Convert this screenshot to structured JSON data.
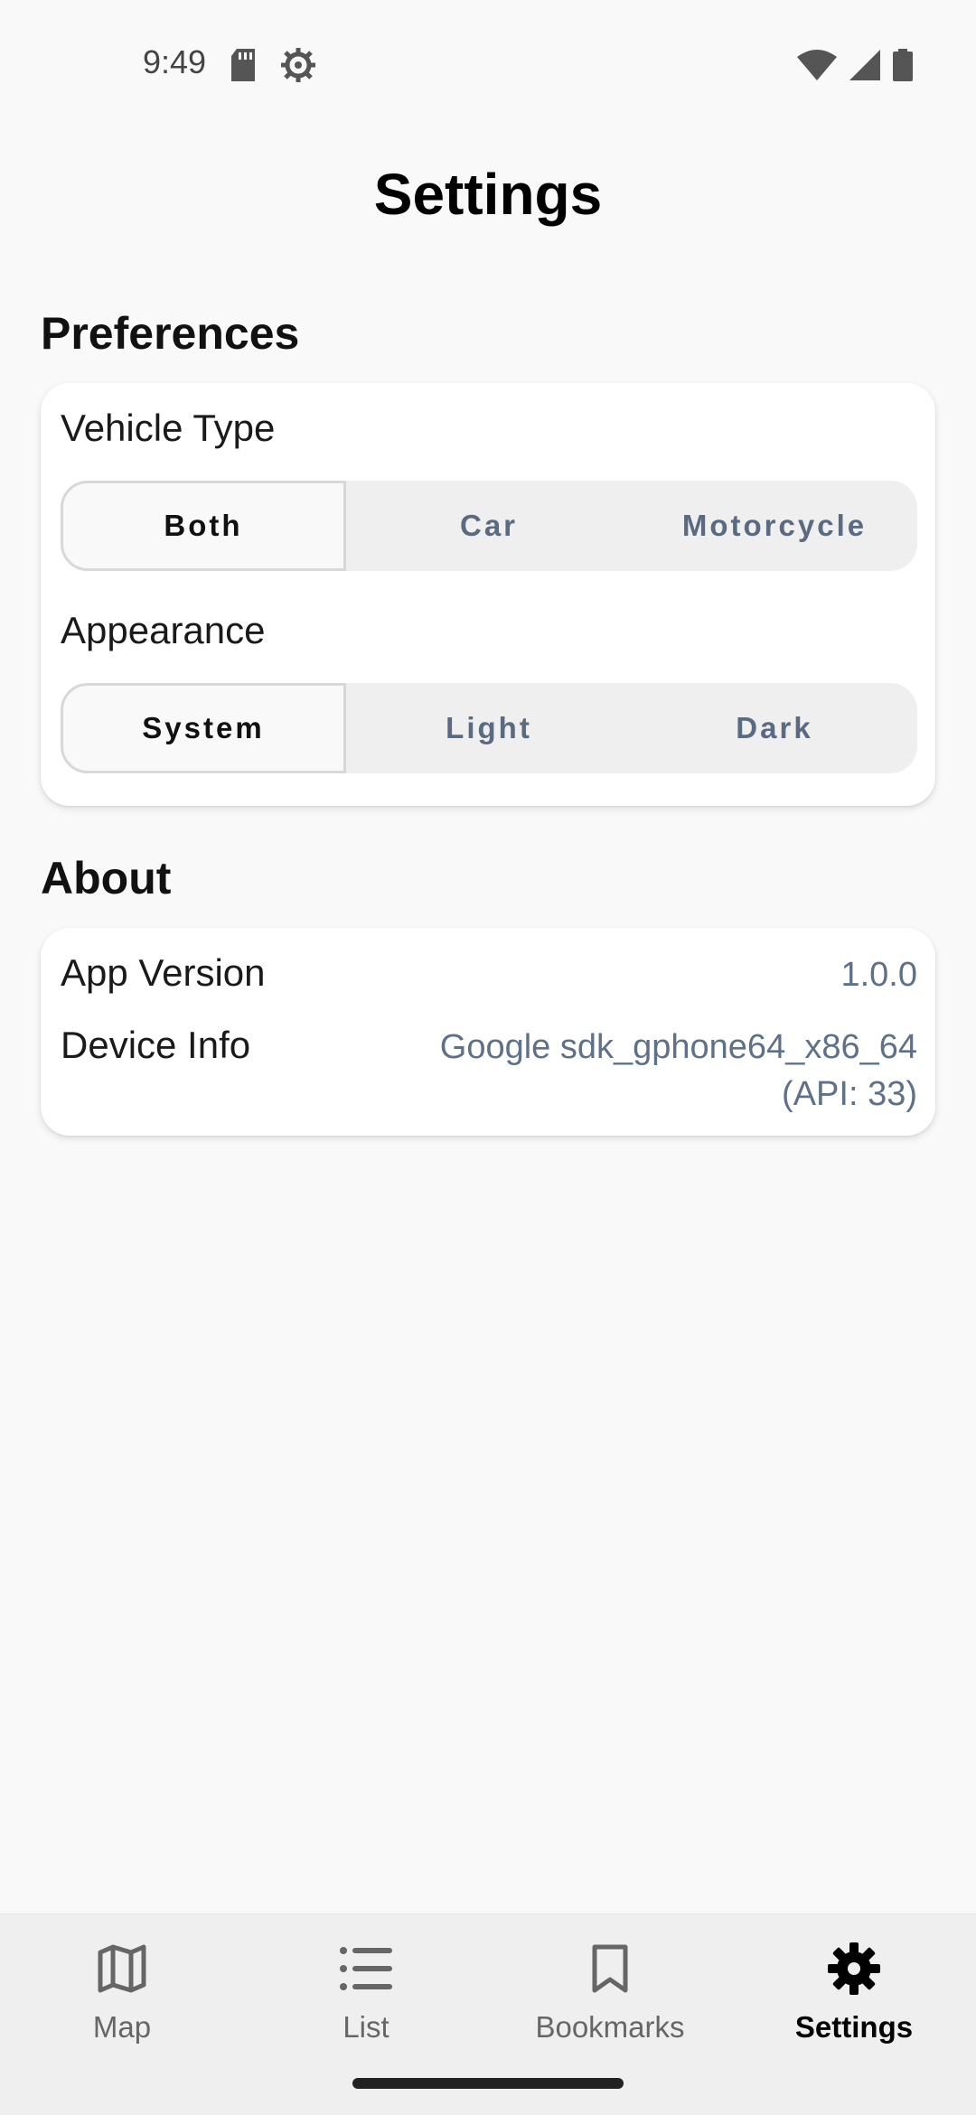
{
  "status_bar": {
    "time": "9:49",
    "icons": [
      "sd-card-icon",
      "settings-gear-icon",
      "wifi-icon",
      "cell-signal-icon",
      "battery-icon"
    ]
  },
  "page": {
    "title": "Settings"
  },
  "preferences": {
    "section_title": "Preferences",
    "vehicle_type": {
      "label": "Vehicle Type",
      "options": [
        "Both",
        "Car",
        "Motorcycle"
      ],
      "selected": "Both"
    },
    "appearance": {
      "label": "Appearance",
      "options": [
        "System",
        "Light",
        "Dark"
      ],
      "selected": "System"
    }
  },
  "about": {
    "section_title": "About",
    "app_version": {
      "label": "App Version",
      "value": "1.0.0"
    },
    "device_info": {
      "label": "Device Info",
      "value_line1": "Google sdk_gphone64_x86_64",
      "value_line2": "(API: 33)"
    }
  },
  "bottom_nav": {
    "items": [
      {
        "label": "Map",
        "icon": "map-icon"
      },
      {
        "label": "List",
        "icon": "list-icon"
      },
      {
        "label": "Bookmarks",
        "icon": "bookmark-icon"
      },
      {
        "label": "Settings",
        "icon": "settings-icon"
      }
    ],
    "active": "Settings"
  },
  "colors": {
    "background": "#f9f9f9",
    "card": "#ffffff",
    "muted_text": "#5f7188",
    "segment_bg": "#efefef"
  }
}
